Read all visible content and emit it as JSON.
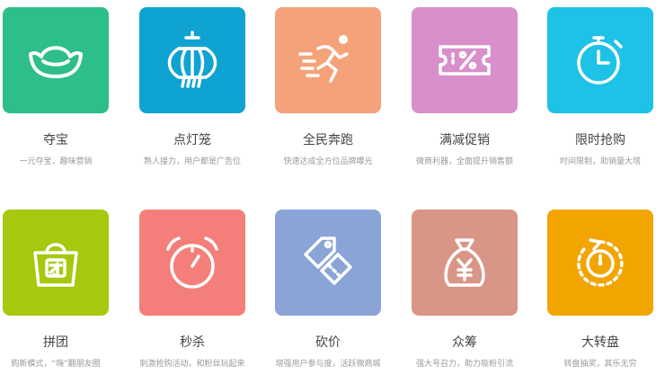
{
  "features": [
    {
      "title": "夺宝",
      "desc": "一元夺宝，趣味营销",
      "color": "#2dbe8a",
      "icon": "ingot-icon"
    },
    {
      "title": "点灯笼",
      "desc": "熟人接力，用户都是广告位",
      "color": "#0ea3d1",
      "icon": "lantern-icon"
    },
    {
      "title": "全民奔跑",
      "desc": "快速达成全方位品牌曝光",
      "color": "#f5a27a",
      "icon": "runner-icon"
    },
    {
      "title": "满减促销",
      "desc": "微商利器，全面提升销售额",
      "color": "#d98fcb",
      "icon": "discount-ticket-icon"
    },
    {
      "title": "限时抢购",
      "desc": "时间限制，助销量大增",
      "color": "#1ec2e6",
      "icon": "stopwatch-icon"
    },
    {
      "title": "拼团",
      "desc": "购新模式，“嗨”翻朋友圈",
      "color": "#a6c80f",
      "icon": "shopping-bag-icon"
    },
    {
      "title": "秒杀",
      "desc": "刺激抢购活动，和粉丝玩起来",
      "color": "#f47f7a",
      "icon": "alarm-clock-icon"
    },
    {
      "title": "砍价",
      "desc": "增强用户参与度，活跃微商城",
      "color": "#8aa4d8",
      "icon": "price-tag-icon"
    },
    {
      "title": "众筹",
      "desc": "强大号召力，助力吸粉引流",
      "color": "#d99687",
      "icon": "money-bag-icon"
    },
    {
      "title": "大转盘",
      "desc": "转盘抽奖，其乐无穷",
      "color": "#f2a400",
      "icon": "spin-wheel-icon"
    }
  ]
}
